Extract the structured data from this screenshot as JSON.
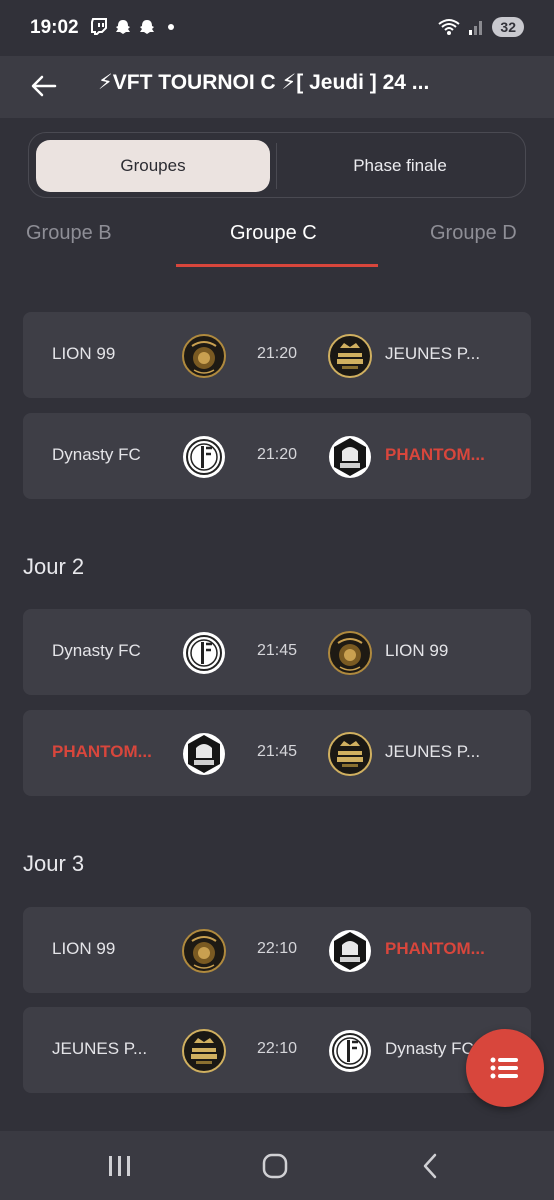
{
  "status_bar": {
    "time": "19:02",
    "battery": "32"
  },
  "app_bar": {
    "title": "⚡VFT TOURNOI C ⚡[ Jeudi ] 24 ..."
  },
  "segments": {
    "left": "Groupes",
    "right": "Phase finale",
    "selected": "Groupes"
  },
  "group_tabs": {
    "prev": "Groupe B",
    "current": "Groupe C",
    "next": "Groupe D"
  },
  "days": [
    {
      "title": "",
      "matches": [
        {
          "home": "LION 99",
          "home_logo": "lion-99-logo",
          "time": "21:20",
          "away": "JEUNES P...",
          "away_logo": "jeunes-prodiges-logo",
          "highlight": ""
        },
        {
          "home": "Dynasty FC",
          "home_logo": "dynasty-fc-logo",
          "time": "21:20",
          "away": "PHANTOM...",
          "away_logo": "phantom-logo",
          "highlight": "away"
        }
      ]
    },
    {
      "title": "Jour 2",
      "matches": [
        {
          "home": "Dynasty FC",
          "home_logo": "dynasty-fc-logo",
          "time": "21:45",
          "away": "LION 99",
          "away_logo": "lion-99-logo",
          "highlight": ""
        },
        {
          "home": "PHANTOM...",
          "home_logo": "phantom-logo",
          "time": "21:45",
          "away": "JEUNES P...",
          "away_logo": "jeunes-prodiges-logo",
          "highlight": "home"
        }
      ]
    },
    {
      "title": "Jour 3",
      "matches": [
        {
          "home": "LION 99",
          "home_logo": "lion-99-logo",
          "time": "22:10",
          "away": "PHANTOM...",
          "away_logo": "phantom-logo",
          "highlight": "away"
        },
        {
          "home": "JEUNES P...",
          "home_logo": "jeunes-prodiges-logo",
          "time": "22:10",
          "away": "Dynasty FC",
          "away_logo": "dynasty-fc-logo",
          "highlight": ""
        }
      ]
    }
  ],
  "colors": {
    "accent": "#d8463c",
    "background": "#313139",
    "card": "#3e3e46",
    "segment_selected": "#ebe3e0"
  },
  "icons": {
    "back": "arrow-left-icon",
    "fab": "list-icon",
    "nav": [
      "recent-apps-icon",
      "home-icon",
      "back-icon"
    ]
  }
}
